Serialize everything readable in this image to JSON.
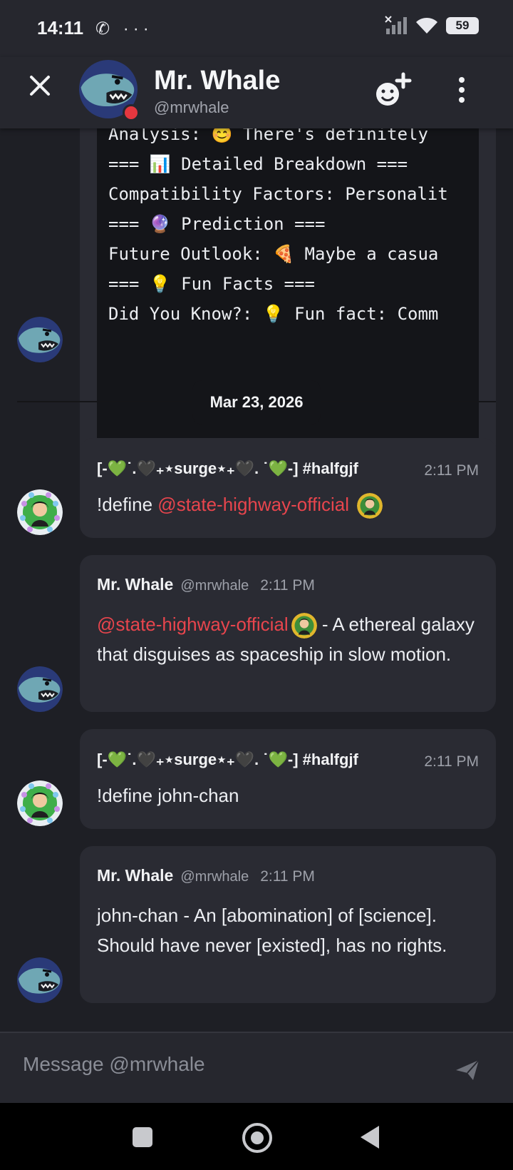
{
  "status_bar": {
    "time": "14:11",
    "icons": "✆ ···",
    "battery": "59"
  },
  "header": {
    "name": "Mr. Whale",
    "handle": "@mrwhale"
  },
  "code_block": {
    "lines": [
      "Analysis: 😊 There's definitely",
      "=== 📊 Detailed Breakdown ===",
      "Compatibility Factors: Personalit",
      "=== 🔮 Prediction ===",
      "Future Outlook: 🍕 Maybe a casua",
      "=== 💡 Fun Facts ===",
      "Did You Know?: 💡 Fun fact: Comm"
    ]
  },
  "date_divider": "Mar 23, 2026",
  "messages": [
    {
      "author": "[-💚˙.🖤₊⋆surge⋆₊🖤. ˙💚-] #halfgjf",
      "timestamp": "2:11 PM",
      "content": "!define ",
      "mention": "@state-highway-official"
    },
    {
      "author": "Mr. Whale",
      "handle": "@mrwhale",
      "timestamp": "2:11 PM",
      "mention": "@state-highway-official",
      "content": " - A ethereal galaxy that disguises as spaceship in slow motion."
    },
    {
      "author": "[-💚˙.🖤₊⋆surge⋆₊🖤. ˙💚-] #halfgjf",
      "timestamp": "2:11 PM",
      "content": "!define john-chan"
    },
    {
      "author": "Mr. Whale",
      "handle": "@mrwhale",
      "timestamp": "2:11 PM",
      "content": "john-chan - An [abomination] of [science]. Should have never [existed], has no rights."
    }
  ],
  "composer": {
    "placeholder": "Message @mrwhale"
  },
  "colors": {
    "background": "#1e1f25",
    "bubble": "#2a2b33",
    "mention": "#e8454d",
    "status_dot": "#e5373f"
  }
}
